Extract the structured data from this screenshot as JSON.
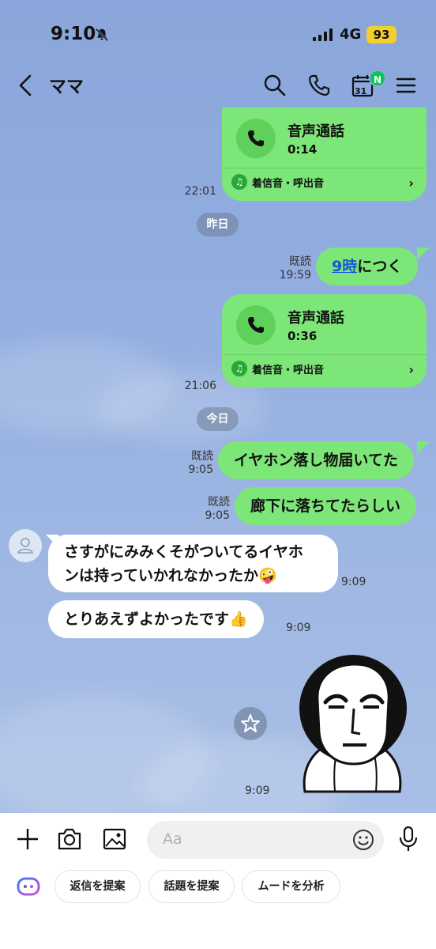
{
  "status_bar": {
    "time": "9:10",
    "network": "4G",
    "battery": "93"
  },
  "header": {
    "title": "ママ",
    "calendar_day": "31",
    "calendar_badge": "N"
  },
  "messages": {
    "call1": {
      "title": "音声通話",
      "duration": "0:14",
      "ringtone": "着信音・呼出音",
      "time": "22:01"
    },
    "date_yesterday": "昨日",
    "msg_9ji": {
      "link_text": "9時",
      "rest": "につく",
      "read": "既読",
      "time": "19:59"
    },
    "call2": {
      "title": "音声通話",
      "duration": "0:36",
      "ringtone": "着信音・呼出音",
      "time": "21:06"
    },
    "date_today": "今日",
    "msg_earphone": {
      "text": "イヤホン落し物届いてた",
      "read": "既読",
      "time": "9:05"
    },
    "msg_hallway": {
      "text": "廊下に落ちてたらしい",
      "read": "既読",
      "time": "9:05"
    },
    "reply1": {
      "line1": "さすがにみみくそがついてるイヤホ",
      "line2": "ンは持っていかれなかったか",
      "emoji": "🤪",
      "time": "9:09"
    },
    "reply2": {
      "text": "とりあえずよかったです",
      "emoji": "👍",
      "time": "9:09"
    },
    "sticker_time": "9:09"
  },
  "composer": {
    "placeholder": "Aa",
    "suggestions": [
      "返信を提案",
      "話題を提案",
      "ムードを分析"
    ]
  },
  "colors": {
    "my_bubble": "#7de678",
    "their_bubble": "#ffffff",
    "line_green": "#06c755",
    "link": "#1b56d6"
  }
}
